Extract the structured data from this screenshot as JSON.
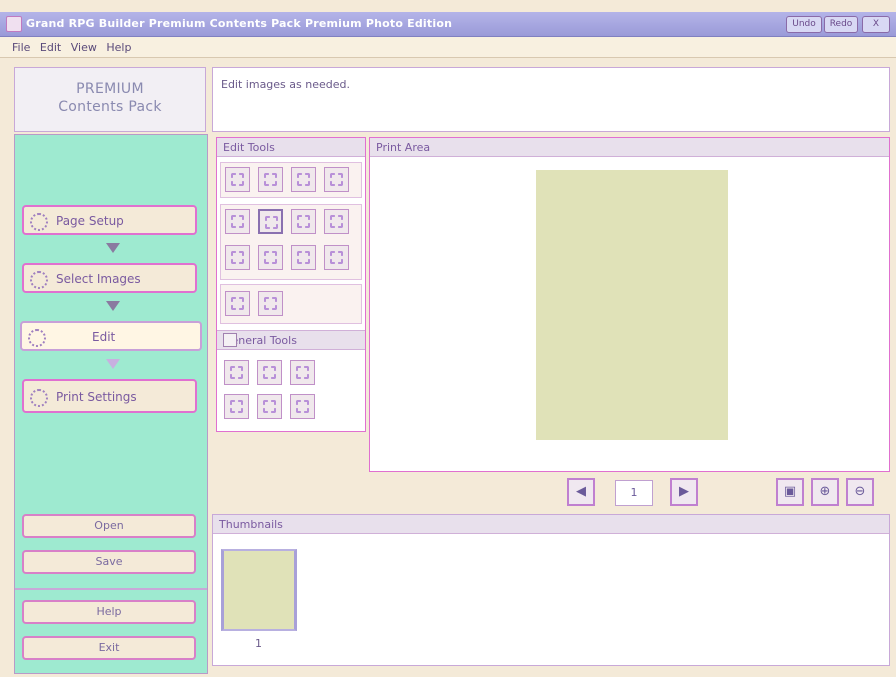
{
  "window": {
    "title": "Grand RPG Builder  Premium Contents Pack  Premium Photo Edition",
    "buttons": [
      "Undo",
      "Redo",
      "X"
    ]
  },
  "menu": [
    "File",
    "Edit",
    "View",
    "Help"
  ],
  "logo": {
    "line1": "PREMIUM",
    "line2": "Contents Pack"
  },
  "instruction": "Edit images as needed.",
  "steps": [
    {
      "label": "Page Setup",
      "icon": "page-setup-icon"
    },
    {
      "label": "Select Images",
      "icon": "select-images-icon"
    },
    {
      "label": "Edit",
      "icon": "edit-icon",
      "active": true
    },
    {
      "label": "Print Settings",
      "icon": "print-settings-icon"
    }
  ],
  "sidebar_buttons": {
    "open": "Open",
    "save": "Save",
    "help": "Help",
    "exit": "Exit"
  },
  "edit_tools": {
    "title": "Edit Tools"
  },
  "general_tools": {
    "title": "General Tools"
  },
  "print_area": {
    "title": "Print Area"
  },
  "nav": {
    "page": "1"
  },
  "thumbnails": {
    "title": "Thumbnails",
    "items": [
      {
        "number": "1"
      }
    ]
  },
  "colors": {
    "sidebar": "#9eead0",
    "accent": "#e070d0",
    "page": "#e0e2b8"
  }
}
